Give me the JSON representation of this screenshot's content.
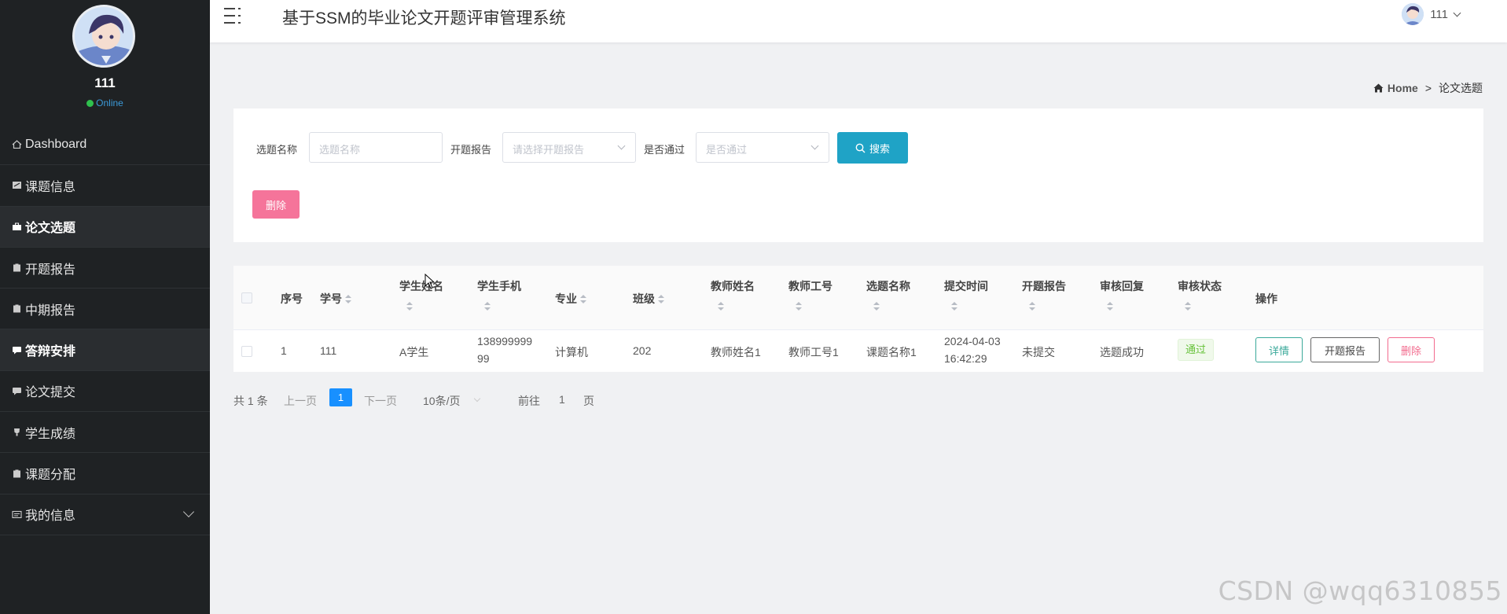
{
  "app": {
    "title": "基于SSM的毕业论文开题评审管理系统"
  },
  "sidebar": {
    "user_name": "111",
    "status": "Online",
    "items": [
      {
        "label": "Dashboard",
        "icon": "home-icon"
      },
      {
        "label": "课题信息",
        "icon": "card-icon"
      },
      {
        "label": "论文选题",
        "icon": "briefcase-icon"
      },
      {
        "label": "开题报告",
        "icon": "clipboard-icon"
      },
      {
        "label": "中期报告",
        "icon": "clipboard-icon"
      },
      {
        "label": "答辩安排",
        "icon": "chat-icon"
      },
      {
        "label": "论文提交",
        "icon": "chat-icon"
      },
      {
        "label": "学生成绩",
        "icon": "trophy-icon"
      },
      {
        "label": "课题分配",
        "icon": "clipboard-icon"
      },
      {
        "label": "我的信息",
        "icon": "id-card-icon"
      }
    ]
  },
  "header": {
    "user": "111"
  },
  "breadcrumb": {
    "home": "Home",
    "separator": ">",
    "current": "论文选题"
  },
  "search": {
    "topic_label": "选题名称",
    "topic_placeholder": "选题名称",
    "report_label": "开题报告",
    "report_placeholder": "请选择开题报告",
    "pass_label": "是否通过",
    "pass_placeholder": "是否通过",
    "search_button": "搜索",
    "delete_button": "删除"
  },
  "table": {
    "headers": [
      "序号",
      "学号",
      "学生姓名",
      "学生手机",
      "专业",
      "班级",
      "教师姓名",
      "教师工号",
      "选题名称",
      "提交时间",
      "开题报告",
      "审核回复",
      "审核状态",
      "操作"
    ],
    "rows": [
      {
        "index": "1",
        "student_id": "111",
        "student_name": "A学生",
        "phone_line1": "138999999",
        "phone_line2": "99",
        "major": "计算机",
        "class": "202",
        "teacher_name": "教师姓名1",
        "teacher_id": "教师工号1",
        "topic": "课题名称1",
        "submit_date": "2024-04-03",
        "submit_time": "16:42:29",
        "report": "未提交",
        "reply": "选题成功",
        "status": "通过",
        "actions": {
          "detail": "详情",
          "report": "开题报告",
          "delete": "删除"
        }
      }
    ]
  },
  "pagination": {
    "total": "共 1 条",
    "prev": "上一页",
    "current": "1",
    "next": "下一页",
    "page_size": "10条/页",
    "goto_prefix": "前往",
    "goto_value": "1",
    "goto_suffix": "页"
  },
  "watermark": "CSDN @wqq6310855",
  "colors": {
    "sidebar_bg": "#1f2224",
    "primary": "#1fa3c6",
    "danger": "#f5749a",
    "page_active": "#1890ff",
    "success": "#67c23a"
  }
}
